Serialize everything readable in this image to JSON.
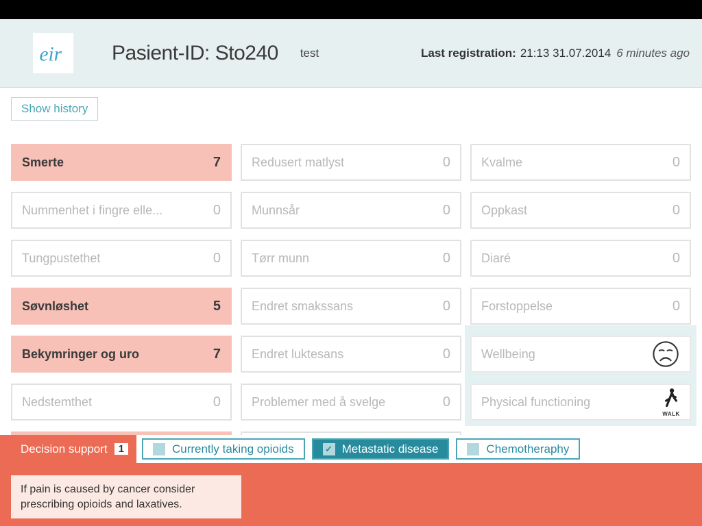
{
  "header": {
    "patient_label": "Pasient-ID: Sto240",
    "patient_sub": "test",
    "last_reg_label": "Last registration:",
    "last_reg_time": "21:13 31.07.2014",
    "last_reg_ago": "6 minutes ago"
  },
  "buttons": {
    "show_history": "Show history"
  },
  "symptoms": [
    {
      "label": "Smerte",
      "value": "7",
      "hot": true
    },
    {
      "label": "Redusert matlyst",
      "value": "0",
      "hot": false
    },
    {
      "label": "Kvalme",
      "value": "0",
      "hot": false
    },
    {
      "label": "Nummenhet i fingre elle...",
      "value": "0",
      "hot": false
    },
    {
      "label": "Munnsår",
      "value": "0",
      "hot": false
    },
    {
      "label": "Oppkast",
      "value": "0",
      "hot": false
    },
    {
      "label": "Tungpustethet",
      "value": "0",
      "hot": false
    },
    {
      "label": "Tørr munn",
      "value": "0",
      "hot": false
    },
    {
      "label": "Diaré",
      "value": "0",
      "hot": false
    },
    {
      "label": "Søvnløshet",
      "value": "5",
      "hot": true
    },
    {
      "label": "Endret smakssans",
      "value": "0",
      "hot": false
    },
    {
      "label": "Forstoppelse",
      "value": "0",
      "hot": false
    },
    {
      "label": "Bekymringer og uro",
      "value": "7",
      "hot": true
    },
    {
      "label": "Endret luktesans",
      "value": "0",
      "hot": false
    },
    {
      "label": "Nedstemthet",
      "value": "0",
      "hot": false
    },
    {
      "label": "Problemer med å svelge",
      "value": "0",
      "hot": false
    }
  ],
  "special": {
    "wellbeing": "Wellbeing",
    "physical": "Physical functioning",
    "walk": "WALK"
  },
  "decision": {
    "label": "Decision support",
    "count": "1",
    "filters": [
      {
        "label": "Currently taking opioids",
        "active": false
      },
      {
        "label": "Metastatic disease",
        "active": true
      },
      {
        "label": "Chemotheraphy",
        "active": false
      }
    ],
    "note": "If pain is caused by cancer consider prescribing opioids and laxatives."
  }
}
